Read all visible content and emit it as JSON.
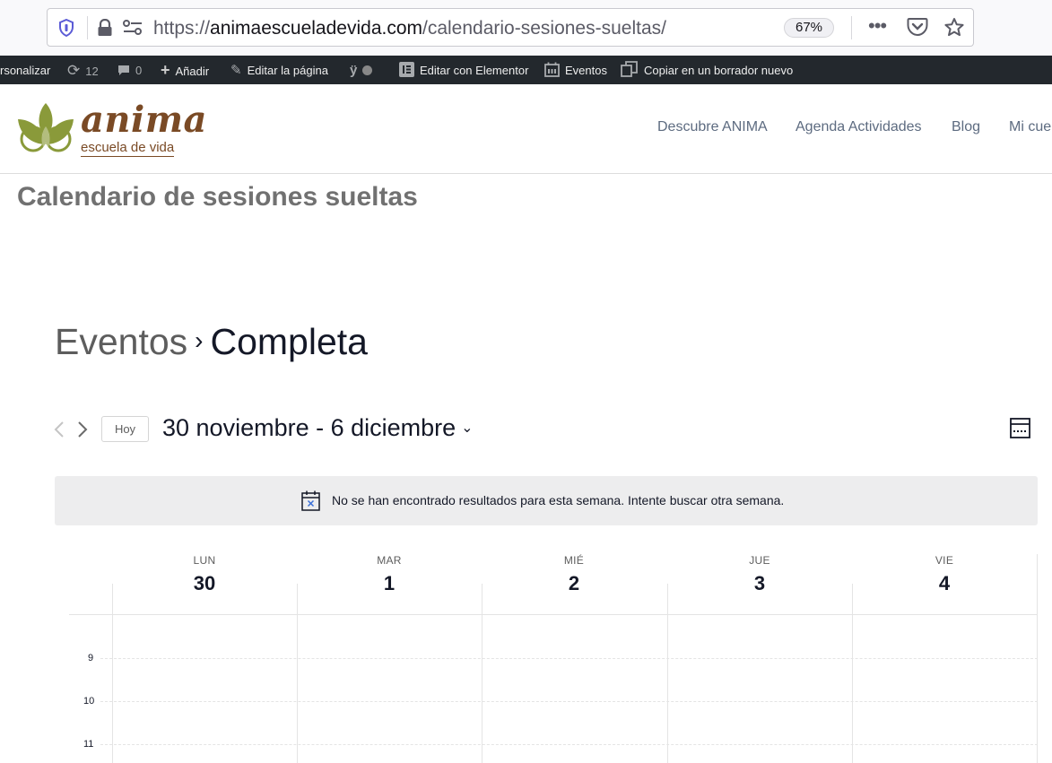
{
  "browser": {
    "url_prefix": "https://",
    "url_domain": "animaescueladevida.com",
    "url_path": "/calendario-sesiones-sueltas/",
    "zoom": "67%",
    "icons": [
      "shield-icon",
      "lock-icon",
      "permissions-icon",
      "more-icon",
      "pocket-icon",
      "star-icon"
    ]
  },
  "adminbar": {
    "customize": "rsonalizar",
    "updates_count": "12",
    "comments_count": "0",
    "add_new": "Añadir",
    "edit_page": "Editar la página",
    "edit_elementor": "Editar con Elementor",
    "events": "Eventos",
    "copy_draft": "Copiar en un borrador nuevo"
  },
  "site": {
    "logo_word": "anima",
    "logo_sub": "escuela de vida",
    "nav": [
      "Descubre ANIMA",
      "Agenda Actividades",
      "Blog",
      "Mi cue"
    ],
    "page_title": "Calendario de sesiones sueltas"
  },
  "events": {
    "breadcrumb_link": "Eventos",
    "breadcrumb_current": "Completa",
    "today_label": "Hoy",
    "date_range": "30 noviembre - 6 diciembre",
    "notice": "No se han encontrado resultados para esta semana. Intente buscar otra semana.",
    "days": [
      {
        "name": "LUN",
        "num": "30"
      },
      {
        "name": "MAR",
        "num": "1"
      },
      {
        "name": "MIÉ",
        "num": "2"
      },
      {
        "name": "JUE",
        "num": "3"
      },
      {
        "name": "VIE",
        "num": "4"
      }
    ],
    "hours": [
      "9",
      "10",
      "11"
    ]
  },
  "colors": {
    "adminbar_bg": "#23282d",
    "logo_brown": "#7a4a25",
    "logo_green": "#8a9a3a",
    "notice_bg": "#ededee"
  }
}
